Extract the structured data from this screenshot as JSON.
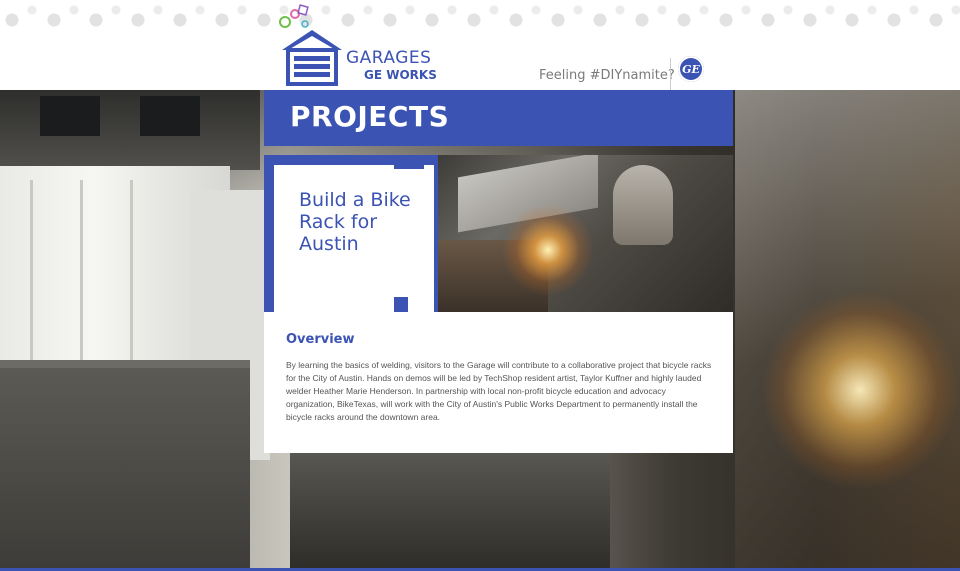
{
  "header": {
    "logo_title": "GARAGES",
    "logo_subtitle": "GE WORKS",
    "tagline": "Feeling #DIYnamite?",
    "ge_logo_text": "GE"
  },
  "banner": {
    "title": "PROJECTS"
  },
  "project": {
    "title": "Build a Bike Rack for Austin",
    "overview_heading": "Overview",
    "overview_body": "By learning the basics of welding, visitors to the Garage will contribute to a collaborative project that bicycle racks for the City of Austin. Hands on demos will be led by TechShop resident artist, Taylor Kuffner and highly lauded welder Heather Marie Henderson. In partnership with local non-profit bicycle education and advocacy organization, BikeTexas, will work with the City of Austin's Public Works Department to permanently install the bicycle racks around the downtown area."
  },
  "colors": {
    "brand_blue": "#3b53b3",
    "tagline_gray": "#7a7a7a",
    "body_text": "#555555"
  },
  "icons": {
    "logo": "garage-door-icon",
    "ge": "ge-monogram-icon"
  }
}
